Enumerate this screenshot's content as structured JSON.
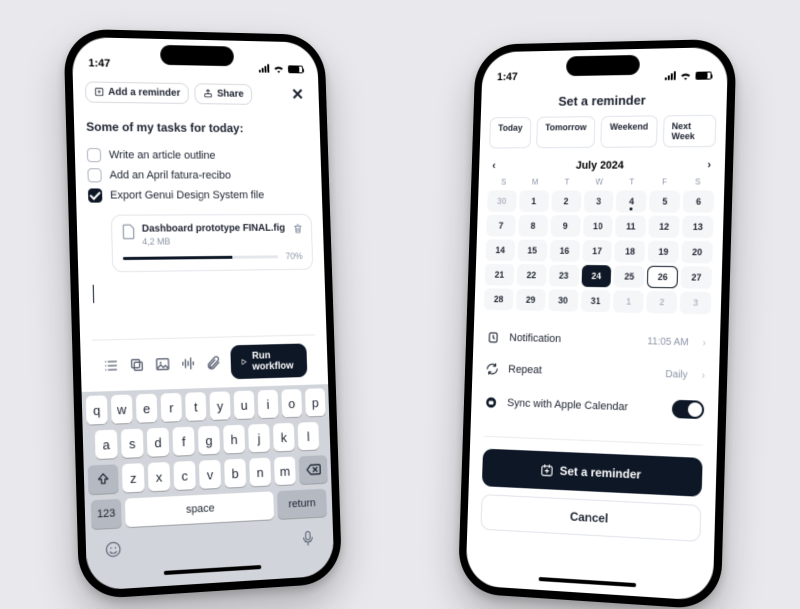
{
  "status": {
    "time": "1:47"
  },
  "left": {
    "toolbar": {
      "add": "Add a reminder",
      "share": "Share"
    },
    "prompt": "Some of my tasks for today:",
    "tasks": [
      {
        "label": "Write an article outline",
        "checked": false
      },
      {
        "label": "Add an April fatura-recibo",
        "checked": false
      },
      {
        "label": "Export Genui Design System file",
        "checked": true
      }
    ],
    "file": {
      "name": "Dashboard prototype FINAL.fig",
      "size": "4,2 MB",
      "pct": "70%",
      "pval": 70
    },
    "run": "Run workflow",
    "kbd": {
      "r1": [
        "q",
        "w",
        "e",
        "r",
        "t",
        "y",
        "u",
        "i",
        "o",
        "p"
      ],
      "r2": [
        "a",
        "s",
        "d",
        "f",
        "g",
        "h",
        "j",
        "k",
        "l"
      ],
      "r3": [
        "z",
        "x",
        "c",
        "v",
        "b",
        "n",
        "m"
      ],
      "num": "123",
      "space": "space",
      "return": "return"
    }
  },
  "right": {
    "title": "Set a reminder",
    "quick": [
      "Today",
      "Tomorrow",
      "Weekend",
      "Next Week"
    ],
    "month": "July 2024",
    "dow": [
      "S",
      "M",
      "T",
      "W",
      "T",
      "F",
      "S"
    ],
    "weeks": [
      [
        {
          "n": "30",
          "mute": true
        },
        {
          "n": "1"
        },
        {
          "n": "2"
        },
        {
          "n": "3"
        },
        {
          "n": "4",
          "dot": true
        },
        {
          "n": "5"
        },
        {
          "n": "6"
        }
      ],
      [
        {
          "n": "7"
        },
        {
          "n": "8"
        },
        {
          "n": "9"
        },
        {
          "n": "10"
        },
        {
          "n": "11"
        },
        {
          "n": "12"
        },
        {
          "n": "13"
        }
      ],
      [
        {
          "n": "14"
        },
        {
          "n": "15"
        },
        {
          "n": "16"
        },
        {
          "n": "17"
        },
        {
          "n": "18"
        },
        {
          "n": "19"
        },
        {
          "n": "20"
        }
      ],
      [
        {
          "n": "21"
        },
        {
          "n": "22"
        },
        {
          "n": "23"
        },
        {
          "n": "24",
          "sel": true
        },
        {
          "n": "25"
        },
        {
          "n": "26",
          "ring": true
        },
        {
          "n": "27"
        }
      ],
      [
        {
          "n": "28"
        },
        {
          "n": "29"
        },
        {
          "n": "30"
        },
        {
          "n": "31"
        },
        {
          "n": "1",
          "mute": true
        },
        {
          "n": "2",
          "mute": true
        },
        {
          "n": "3",
          "mute": true
        }
      ]
    ],
    "notif": {
      "label": "Notification",
      "value": "11:05 AM"
    },
    "repeat": {
      "label": "Repeat",
      "value": "Daily"
    },
    "sync": {
      "label": "Sync with Apple Calendar"
    },
    "cta": "Set a reminder",
    "cancel": "Cancel"
  }
}
